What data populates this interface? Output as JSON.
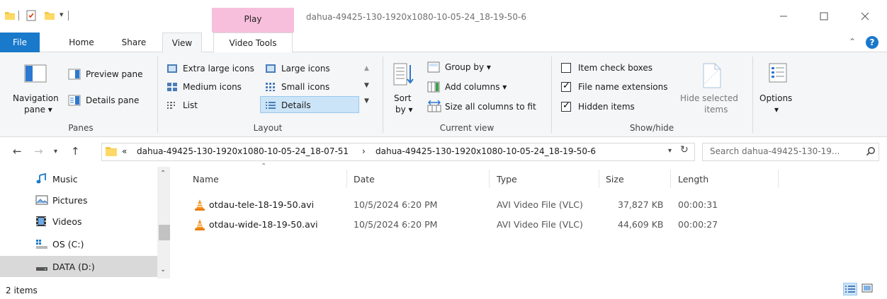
{
  "window": {
    "title": "dahua-49425-130-1920x1080-10-05-24_18-19-50-6",
    "context_tab": "Play"
  },
  "ribbon_tabs": {
    "file": "File",
    "home": "Home",
    "share": "Share",
    "view": "View",
    "video_tools": "Video Tools"
  },
  "ribbon": {
    "panes": {
      "navigation_pane_line1": "Navigation",
      "navigation_pane_line2": "pane ▾",
      "preview_pane": "Preview pane",
      "details_pane": "Details pane",
      "group_label": "Panes"
    },
    "layout": {
      "extra_large_icons": "Extra large icons",
      "large_icons": "Large icons",
      "medium_icons": "Medium icons",
      "small_icons": "Small icons",
      "list": "List",
      "details": "Details",
      "group_label": "Layout"
    },
    "current_view": {
      "sort_line1": "Sort",
      "sort_line2": "by ▾",
      "group_by": "Group by ▾",
      "add_columns": "Add columns ▾",
      "size_all_columns": "Size all columns to fit",
      "group_label": "Current view"
    },
    "show_hide": {
      "item_check_boxes": "Item check boxes",
      "file_name_extensions": "File name extensions",
      "hidden_items": "Hidden items",
      "hide_selected_line1": "Hide selected",
      "hide_selected_line2": "items",
      "group_label": "Show/hide",
      "item_check_boxes_checked": false,
      "file_name_extensions_checked": true,
      "hidden_items_checked": true
    },
    "options": {
      "label": "Options",
      "arrow": "▾"
    }
  },
  "address": {
    "overflow": "«",
    "crumb1": "dahua-49425-130-1920x1080-10-05-24_18-07-51",
    "separator": "›",
    "crumb2": "dahua-49425-130-1920x1080-10-05-24_18-19-50-6",
    "search_placeholder": "Search dahua-49425-130-19..."
  },
  "nav": {
    "items": [
      {
        "label": "Music",
        "icon": "music-icon"
      },
      {
        "label": "Pictures",
        "icon": "pictures-icon"
      },
      {
        "label": "Videos",
        "icon": "videos-icon"
      },
      {
        "label": "OS (C:)",
        "icon": "drive-os-icon"
      },
      {
        "label": "DATA (D:)",
        "icon": "drive-icon"
      }
    ]
  },
  "columns": {
    "name": "Name",
    "date": "Date",
    "type": "Type",
    "size": "Size",
    "length": "Length"
  },
  "files": [
    {
      "name": "otdau-tele-18-19-50.avi",
      "date": "10/5/2024 6:20 PM",
      "type": "AVI Video File (VLC)",
      "size": "37,827 KB",
      "length": "00:00:31"
    },
    {
      "name": "otdau-wide-18-19-50.avi",
      "date": "10/5/2024 6:20 PM",
      "type": "AVI Video File (VLC)",
      "size": "44,609 KB",
      "length": "00:00:27"
    }
  ],
  "status": {
    "item_count": "2 items"
  },
  "colors": {
    "file_tab": "#1979ca",
    "play_tab": "#f8bfdc",
    "selection": "#cce4f7"
  }
}
